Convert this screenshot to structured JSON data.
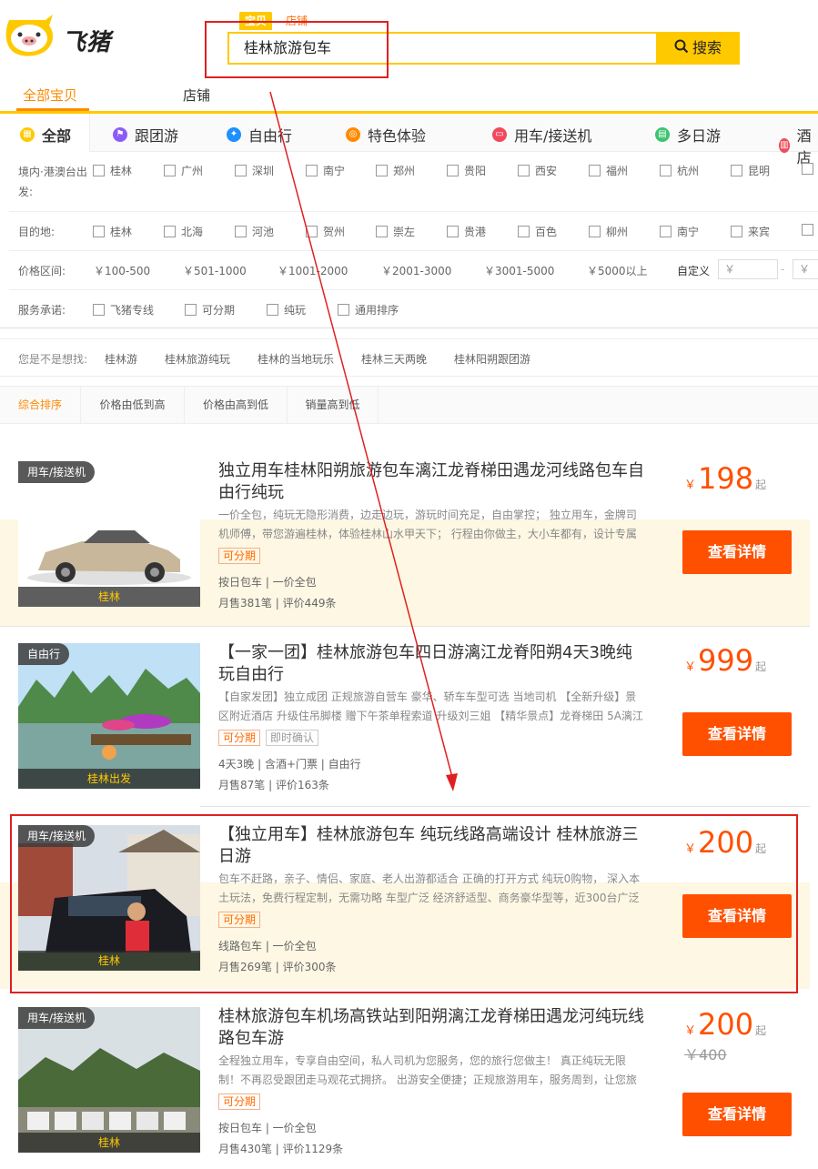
{
  "header": {
    "logo_text": "飞猪",
    "search_tabs": [
      "宝贝",
      "店铺"
    ],
    "search_value": "桂林旅游包车",
    "search_button": "搜索"
  },
  "nav": {
    "tabs": [
      "全部宝贝",
      "店铺"
    ]
  },
  "categories": [
    {
      "label": "全部",
      "color": "#ffc900"
    },
    {
      "label": "跟团游",
      "color": "#8b5cf6"
    },
    {
      "label": "自由行",
      "color": "#1e90ff"
    },
    {
      "label": "特色体验",
      "color": "#ff8a00"
    },
    {
      "label": "用车/接送机",
      "color": "#f04a5c"
    },
    {
      "label": "多日游",
      "color": "#3ec46d"
    },
    {
      "label": "酒店",
      "color": "#f04a5c"
    }
  ],
  "filters": {
    "depart_label": "境内·港澳台出发:",
    "depart": [
      "桂林",
      "广州",
      "深圳",
      "南宁",
      "郑州",
      "贵阳",
      "西安",
      "福州",
      "杭州",
      "昆明"
    ],
    "dest_label": "目的地:",
    "dest": [
      "桂林",
      "北海",
      "河池",
      "贺州",
      "崇左",
      "贵港",
      "百色",
      "柳州",
      "南宁",
      "来宾"
    ],
    "price_label": "价格区间:",
    "prices": [
      "￥100-500",
      "￥501-1000",
      "￥1001-2000",
      "￥2001-3000",
      "￥3001-5000",
      "￥5000以上"
    ],
    "custom_label": "自定义",
    "price_placeholder": "￥",
    "dash": "-",
    "service_label": "服务承诺:",
    "services": [
      "飞猪专线",
      "可分期",
      "纯玩",
      "通用排序"
    ]
  },
  "suggest": {
    "label": "您是不是想找:",
    "items": [
      "桂林游",
      "桂林旅游纯玩",
      "桂林的当地玩乐",
      "桂林三天两晚",
      "桂林阳朔跟团游"
    ]
  },
  "sort": [
    "综合排序",
    "价格由低到高",
    "价格由高到低",
    "销量高到低"
  ],
  "products": [
    {
      "tag": "用车/接送机",
      "loc": "桂林",
      "title": "独立用车桂林阳朔旅游包车漓江龙脊梯田遇龙河线路包车自由行纯玩",
      "desc": "一价全包，纯玩无隐形消费，边走边玩，游玩时间充足，自由掌控； 独立用车，金牌司机师傅，带您游遍桂林，体验桂林山水甲天下； 行程由你做主，大小车都有，设计专属",
      "badges": [
        "可分期"
      ],
      "meta": "按日包车 | 一价全包",
      "sales": "月售381笔 | 评价449条",
      "currency": "￥",
      "price": "198",
      "qi": "起",
      "old": "",
      "button": "查看详情"
    },
    {
      "tag": "自由行",
      "loc": "桂林出发",
      "title": "【一家一团】桂林旅游包车四日游漓江龙脊阳朔4天3晚纯玩自由行",
      "desc": "【自家发团】独立成团 正规旅游自营车 豪华、轿车车型可选 当地司机 【全新升级】景区附近酒店 升级住吊脚楼 赠下午茶单程索道 升级刘三姐 【精华景点】龙脊梯田 5A漓江",
      "badges": [
        "可分期",
        "即时确认"
      ],
      "meta": "4天3晚 | 含酒+门票 | 自由行",
      "sales": "月售87笔 | 评价163条",
      "currency": "￥",
      "price": "999",
      "qi": "起",
      "old": "",
      "button": "查看详情"
    },
    {
      "tag": "用车/接送机",
      "loc": "桂林",
      "title": "【独立用车】桂林旅游包车 纯玩线路高端设计 桂林旅游三日游",
      "desc": "包车不赶路，亲子、情侣、家庭、老人出游都适合 正确的打开方式 纯玩0购物， 深入本土玩法，免费行程定制，无需功略 车型广泛 经济舒适型、商务豪华型等，近300台广泛",
      "badges": [
        "可分期"
      ],
      "meta": "线路包车 | 一价全包",
      "sales": "月售269笔 | 评价300条",
      "currency": "￥",
      "price": "200",
      "qi": "起",
      "old": "",
      "button": "查看详情"
    },
    {
      "tag": "用车/接送机",
      "loc": "桂林",
      "title": "桂林旅游包车机场高铁站到阳朔漓江龙脊梯田遇龙河纯玩线路包车游",
      "desc": "全程独立用车，专享自由空间，私人司机为您服务，您的旅行您做主！ 真正纯玩无限制！不再忍受跟团走马观花式拥挤。 出游安全便捷；正规旅游用车，服务周到，让您旅",
      "badges": [
        "可分期"
      ],
      "meta": "按日包车 | 一价全包",
      "sales": "月售430笔 | 评价1129条",
      "currency": "￥",
      "price": "200",
      "qi": "起",
      "old": "400",
      "button": "查看详情"
    }
  ]
}
